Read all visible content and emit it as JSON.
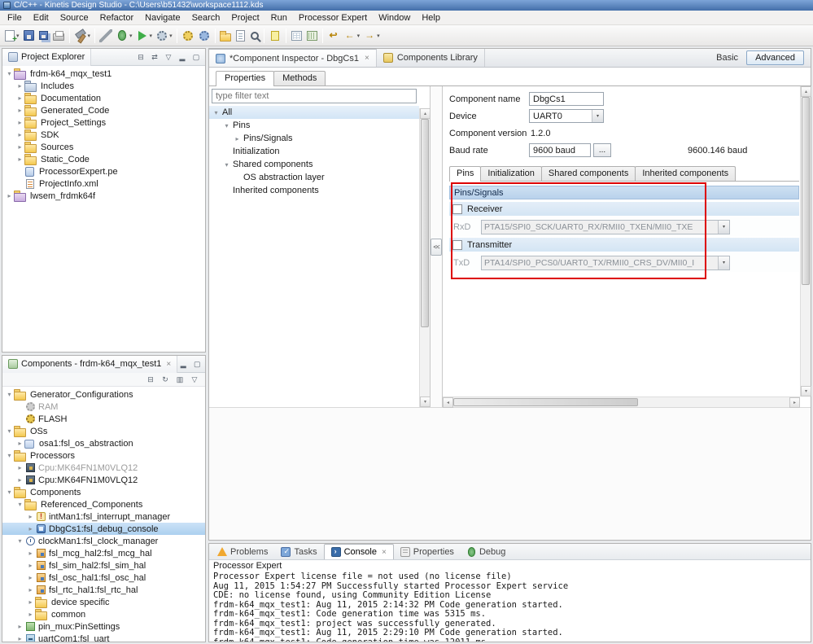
{
  "window": {
    "title": "C/C++ - Kinetis Design Studio - C:\\Users\\b51432\\workspace1112.kds"
  },
  "glyphs": {
    "dropdown": "▾",
    "close": "×",
    "up": "▴",
    "down": "▾",
    "left": "◂",
    "right": "▸",
    "expander_open": "▾",
    "expander_closed": "▸"
  },
  "menu": [
    "File",
    "Edit",
    "Source",
    "Refactor",
    "Navigate",
    "Search",
    "Project",
    "Run",
    "Processor Expert",
    "Window",
    "Help"
  ],
  "toolbar": [
    [
      {
        "name": "new-wizard",
        "kind": "doc-new",
        "dd": true
      },
      {
        "name": "save",
        "kind": "floppy"
      },
      {
        "name": "save-all",
        "kind": "floppy-all"
      },
      {
        "name": "print",
        "kind": "printer"
      }
    ],
    [
      {
        "name": "build-all",
        "kind": "hammer",
        "dd": true
      }
    ],
    [
      {
        "name": "cut",
        "kind": "knife"
      },
      {
        "name": "debug",
        "kind": "bug",
        "dd": true
      },
      {
        "name": "run",
        "kind": "play",
        "dd": true
      },
      {
        "name": "external-tools",
        "kind": "gear-run",
        "dd": true
      }
    ],
    [
      {
        "name": "pe-generate-code",
        "kind": "gear-yellow"
      },
      {
        "name": "pe-component-inspector",
        "kind": "gear-blue"
      }
    ],
    [
      {
        "name": "new-folder",
        "kind": "folder"
      },
      {
        "name": "open-element",
        "kind": "doc"
      },
      {
        "name": "search",
        "kind": "search"
      }
    ],
    [
      {
        "name": "toggle-mark-occurrences",
        "kind": "marker"
      }
    ],
    [
      {
        "name": "table-view",
        "kind": "grid"
      },
      {
        "name": "pin-view",
        "kind": "grid2"
      }
    ],
    [
      {
        "name": "last-edit-location",
        "kind": "glyph",
        "glyph": "↩"
      },
      {
        "name": "back",
        "kind": "glyph",
        "glyph": "←",
        "dd": true
      },
      {
        "name": "forward",
        "kind": "glyph",
        "glyph": "→",
        "dd": true
      }
    ]
  ],
  "project_explorer": {
    "title": "Project Explorer",
    "header_icons": [
      {
        "name": "collapse-all-icon",
        "glyph": "⊟"
      },
      {
        "name": "link-editor-icon",
        "glyph": "⇄"
      },
      {
        "name": "view-menu-icon",
        "glyph": "▽"
      },
      {
        "name": "minimize-icon",
        "glyph": "▂"
      },
      {
        "name": "maximize-icon",
        "glyph": "▢"
      }
    ],
    "tree": [
      {
        "lvl": 0,
        "exp": "open",
        "icon": "project",
        "label": "frdm-k64_mqx_test1"
      },
      {
        "lvl": 1,
        "exp": "closed",
        "icon": "includes",
        "label": "Includes"
      },
      {
        "lvl": 1,
        "exp": "closed",
        "icon": "folder",
        "label": "Documentation"
      },
      {
        "lvl": 1,
        "exp": "closed",
        "icon": "folder",
        "label": "Generated_Code"
      },
      {
        "lvl": 1,
        "exp": "closed",
        "icon": "folder",
        "label": "Project_Settings"
      },
      {
        "lvl": 1,
        "exp": "closed",
        "icon": "folder",
        "label": "SDK"
      },
      {
        "lvl": 1,
        "exp": "closed",
        "icon": "folder",
        "label": "Sources"
      },
      {
        "lvl": 1,
        "exp": "closed",
        "icon": "folder",
        "label": "Static_Code"
      },
      {
        "lvl": 1,
        "icon": "file-pe",
        "label": "ProcessorExpert.pe"
      },
      {
        "lvl": 1,
        "icon": "file-xml",
        "label": "ProjectInfo.xml"
      },
      {
        "lvl": 0,
        "exp": "closed",
        "icon": "project",
        "label": "lwsem_frdmk64f"
      }
    ]
  },
  "components_view": {
    "title": "Components - frdm-k64_mqx_test1",
    "header_icons": [
      {
        "name": "minimize-icon",
        "glyph": "▂"
      },
      {
        "name": "maximize-icon",
        "glyph": "▢"
      }
    ],
    "toolbar_icons": [
      {
        "name": "collapse-all-icon",
        "glyph": "⊟"
      },
      {
        "name": "components-sync-icon",
        "glyph": "↻"
      },
      {
        "name": "components-library-icon",
        "glyph": "▥"
      },
      {
        "name": "view-menu-icon",
        "glyph": "▽"
      }
    ],
    "tree": [
      {
        "lvl": 0,
        "exp": "open",
        "icon": "folder",
        "label": "Generator_Configurations"
      },
      {
        "lvl": 1,
        "icon": "gear-gray",
        "label": "RAM",
        "gray": true
      },
      {
        "lvl": 1,
        "icon": "gear",
        "label": "FLASH"
      },
      {
        "lvl": 0,
        "exp": "open",
        "icon": "folder",
        "label": "OSs"
      },
      {
        "lvl": 1,
        "exp": "closed",
        "icon": "os",
        "label": "osa1:fsl_os_abstraction"
      },
      {
        "lvl": 0,
        "exp": "open",
        "icon": "folder",
        "label": "Processors"
      },
      {
        "lvl": 1,
        "exp": "closed",
        "icon": "chip",
        "label": "Cpu:MK64FN1M0VLQ12",
        "gray": true
      },
      {
        "lvl": 1,
        "exp": "closed",
        "icon": "chip",
        "label": "Cpu:MK64FN1M0VLQ12"
      },
      {
        "lvl": 0,
        "exp": "open",
        "icon": "folder",
        "label": "Components"
      },
      {
        "lvl": 1,
        "exp": "open",
        "icon": "folder",
        "label": "Referenced_Components"
      },
      {
        "lvl": 2,
        "exp": "closed",
        "icon": "comp-int",
        "label": "intMan1:fsl_interrupt_manager"
      },
      {
        "lvl": 2,
        "exp": "closed",
        "icon": "comp-dbg",
        "label": "DbgCs1:fsl_debug_console",
        "selected": true
      },
      {
        "lvl": 1,
        "exp": "open",
        "icon": "comp-clock",
        "label": "clockMan1:fsl_clock_manager"
      },
      {
        "lvl": 2,
        "exp": "closed",
        "icon": "comp-hal",
        "label": "fsl_mcg_hal2:fsl_mcg_hal"
      },
      {
        "lvl": 2,
        "exp": "closed",
        "icon": "comp-hal",
        "label": "fsl_sim_hal2:fsl_sim_hal"
      },
      {
        "lvl": 2,
        "exp": "closed",
        "icon": "comp-hal",
        "label": "fsl_osc_hal1:fsl_osc_hal"
      },
      {
        "lvl": 2,
        "exp": "closed",
        "icon": "comp-hal",
        "label": "fsl_rtc_hal1:fsl_rtc_hal"
      },
      {
        "lvl": 2,
        "exp": "closed",
        "icon": "folder",
        "label": "device specific"
      },
      {
        "lvl": 2,
        "exp": "closed",
        "icon": "folder",
        "label": "common"
      },
      {
        "lvl": 1,
        "exp": "closed",
        "icon": "comp-pin",
        "label": "pin_mux:PinSettings"
      },
      {
        "lvl": 1,
        "exp": "closed",
        "icon": "comp-uart",
        "label": "uartCom1:fsl_uart"
      }
    ]
  },
  "editor": {
    "tabs": [
      {
        "label": "*Component Inspector - DbgCs1",
        "icon": "inspector",
        "active": true,
        "closable": true
      },
      {
        "label": "Components Library",
        "icon": "library"
      }
    ],
    "mode": {
      "basic": "Basic",
      "advanced": "Advanced"
    },
    "subtabs": [
      {
        "label": "Properties",
        "active": true
      },
      {
        "label": "Methods"
      }
    ],
    "filter_placeholder": "type filter text",
    "collapse_label": "<<",
    "prop_tree": [
      {
        "lvl": 0,
        "exp": "open",
        "label": "All",
        "selected": true
      },
      {
        "lvl": 1,
        "exp": "open",
        "label": "Pins"
      },
      {
        "lvl": 2,
        "exp": "closed",
        "label": "Pins/Signals"
      },
      {
        "lvl": 1,
        "label": "Initialization"
      },
      {
        "lvl": 1,
        "exp": "open",
        "label": "Shared components"
      },
      {
        "lvl": 2,
        "label": "OS abstraction layer"
      },
      {
        "lvl": 1,
        "label": "Inherited components"
      }
    ],
    "fields": {
      "component_name_label": "Component name",
      "component_name": "DbgCs1",
      "device_label": "Device",
      "device": "UART0",
      "version_label": "Component version",
      "version": "1.2.0",
      "baud_label": "Baud rate",
      "baud": "9600 baud",
      "baud_btn": "...",
      "baud_actual": "9600.146 baud"
    },
    "detail_tabs": [
      {
        "label": "Pins",
        "active": true
      },
      {
        "label": "Initialization"
      },
      {
        "label": "Shared components"
      },
      {
        "label": "Inherited components"
      }
    ],
    "pins": {
      "group": "Pins/Signals",
      "annotation_color": "#dd0000",
      "rows": [
        {
          "type": "check",
          "label": "Receiver",
          "checked": false
        },
        {
          "type": "pin",
          "label": "RxD",
          "value": "PTA15/SPI0_SCK/UART0_RX/RMII0_TXEN/MII0_TXE"
        },
        {
          "type": "check",
          "label": "Transmitter",
          "checked": false
        },
        {
          "type": "pin",
          "label": "TxD",
          "value": "PTA14/SPI0_PCS0/UART0_TX/RMII0_CRS_DV/MII0_I"
        }
      ]
    }
  },
  "console": {
    "tabs": [
      {
        "label": "Problems",
        "icon": "problems"
      },
      {
        "label": "Tasks",
        "icon": "tasks"
      },
      {
        "label": "Console",
        "icon": "console",
        "active": true,
        "closable": true
      },
      {
        "label": "Properties",
        "icon": "properties"
      },
      {
        "label": "Debug",
        "icon": "debug"
      }
    ],
    "title": "Processor Expert",
    "lines": [
      "Processor Expert license file = not used (no license file)",
      "Aug 11, 2015 1:54:27 PM Successfully started Processor Expert service",
      "CDE: no license found, using Community Edition License",
      "frdm-k64_mqx_test1: Aug 11, 2015 2:14:32 PM Code generation started.",
      "frdm-k64_mqx_test1: Code generation time was 5315 ms.",
      "frdm-k64_mqx_test1: project was successfully generated.",
      "frdm-k64_mqx_test1: Aug 11, 2015 2:29:10 PM Code generation started.",
      "frdm-k64_mqx_test1: Code generation time was 12011 ms."
    ]
  }
}
